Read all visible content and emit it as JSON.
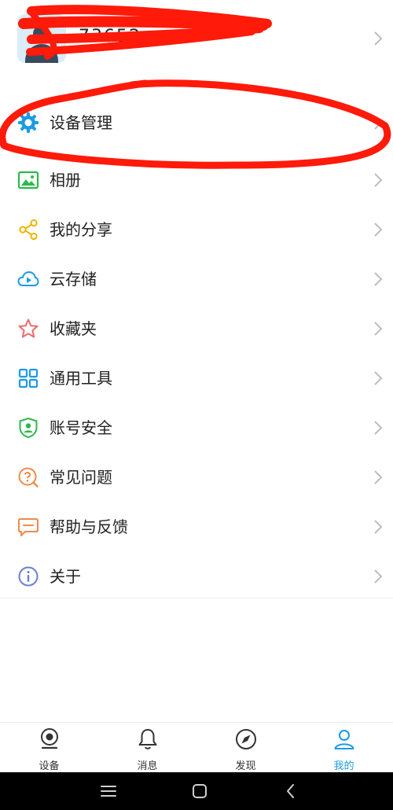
{
  "profile": {
    "name": "73652"
  },
  "menu": [
    {
      "key": "device",
      "label": "设备管理",
      "icon": "gear-icon",
      "color": "#1a9be6"
    },
    {
      "key": "album",
      "label": "相册",
      "icon": "image-icon",
      "color": "#2db84d"
    },
    {
      "key": "share",
      "label": "我的分享",
      "icon": "share-icon",
      "color": "#f0b400"
    },
    {
      "key": "cloud",
      "label": "云存储",
      "icon": "cloud-play-icon",
      "color": "#1a9be6"
    },
    {
      "key": "favorites",
      "label": "收藏夹",
      "icon": "star-icon",
      "color": "#f06a6a"
    },
    {
      "key": "tools",
      "label": "通用工具",
      "icon": "grid-icon",
      "color": "#1a9be6"
    },
    {
      "key": "security",
      "label": "账号安全",
      "icon": "shield-icon",
      "color": "#2db84d"
    },
    {
      "key": "faq",
      "label": "常见问题",
      "icon": "question-icon",
      "color": "#f08a4a"
    },
    {
      "key": "feedback",
      "label": "帮助与反馈",
      "icon": "chat-icon",
      "color": "#f08a4a"
    },
    {
      "key": "about",
      "label": "关于",
      "icon": "info-icon",
      "color": "#6a7fd0"
    }
  ],
  "tabs": [
    {
      "label": "设备",
      "icon": "camera-icon"
    },
    {
      "label": "消息",
      "icon": "bell-icon"
    },
    {
      "label": "发现",
      "icon": "compass-icon"
    },
    {
      "label": "我的",
      "icon": "person-icon",
      "active": true
    }
  ],
  "colors": {
    "accent": "#1a9be6",
    "scribble": "#ff1a0a"
  }
}
